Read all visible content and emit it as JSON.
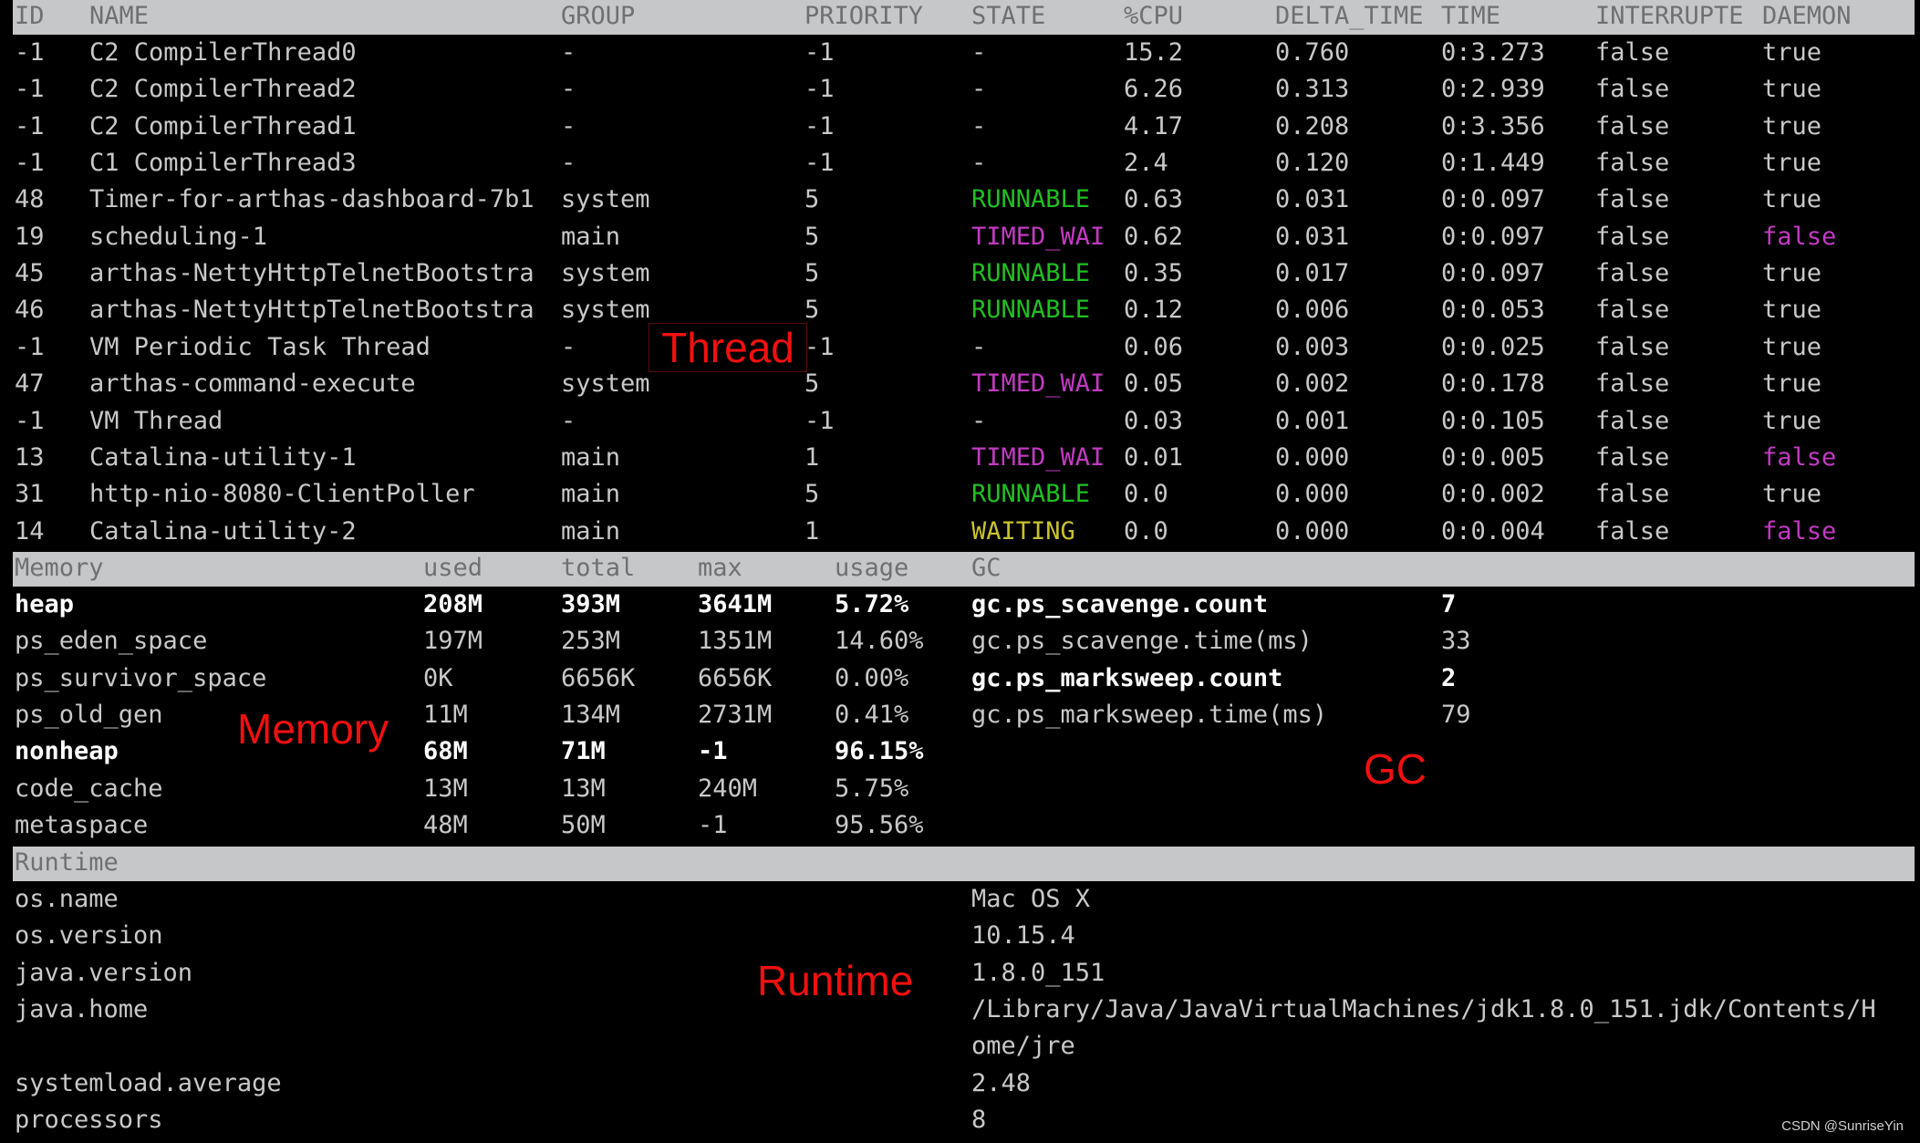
{
  "thread": {
    "headers": [
      "ID",
      "NAME",
      "GROUP",
      "PRIORITY",
      "STATE",
      "%CPU",
      "DELTA_TIME",
      "TIME",
      "INTERRUPTE",
      "DAEMON"
    ],
    "rows": [
      {
        "id": "-1",
        "name": "C2 CompilerThread0",
        "group": "-",
        "priority": "-1",
        "state": "-",
        "cpu": "15.2",
        "delta": "0.760",
        "time": "0:3.273",
        "interrupted": "false",
        "daemon": "true"
      },
      {
        "id": "-1",
        "name": "C2 CompilerThread2",
        "group": "-",
        "priority": "-1",
        "state": "-",
        "cpu": "6.26",
        "delta": "0.313",
        "time": "0:2.939",
        "interrupted": "false",
        "daemon": "true"
      },
      {
        "id": "-1",
        "name": "C2 CompilerThread1",
        "group": "-",
        "priority": "-1",
        "state": "-",
        "cpu": "4.17",
        "delta": "0.208",
        "time": "0:3.356",
        "interrupted": "false",
        "daemon": "true"
      },
      {
        "id": "-1",
        "name": "C1 CompilerThread3",
        "group": "-",
        "priority": "-1",
        "state": "-",
        "cpu": "2.4",
        "delta": "0.120",
        "time": "0:1.449",
        "interrupted": "false",
        "daemon": "true"
      },
      {
        "id": "48",
        "name": "Timer-for-arthas-dashboard-7b1",
        "group": "system",
        "priority": "5",
        "state": "RUNNABLE",
        "cpu": "0.63",
        "delta": "0.031",
        "time": "0:0.097",
        "interrupted": "false",
        "daemon": "true"
      },
      {
        "id": "19",
        "name": "scheduling-1",
        "group": "main",
        "priority": "5",
        "state": "TIMED_WAI",
        "cpu": "0.62",
        "delta": "0.031",
        "time": "0:0.097",
        "interrupted": "false",
        "daemon": "false"
      },
      {
        "id": "45",
        "name": "arthas-NettyHttpTelnetBootstra",
        "group": "system",
        "priority": "5",
        "state": "RUNNABLE",
        "cpu": "0.35",
        "delta": "0.017",
        "time": "0:0.097",
        "interrupted": "false",
        "daemon": "true"
      },
      {
        "id": "46",
        "name": "arthas-NettyHttpTelnetBootstra",
        "group": "system",
        "priority": "5",
        "state": "RUNNABLE",
        "cpu": "0.12",
        "delta": "0.006",
        "time": "0:0.053",
        "interrupted": "false",
        "daemon": "true"
      },
      {
        "id": "-1",
        "name": "VM Periodic Task Thread",
        "group": "-",
        "priority": "-1",
        "state": "-",
        "cpu": "0.06",
        "delta": "0.003",
        "time": "0:0.025",
        "interrupted": "false",
        "daemon": "true"
      },
      {
        "id": "47",
        "name": "arthas-command-execute",
        "group": "system",
        "priority": "5",
        "state": "TIMED_WAI",
        "cpu": "0.05",
        "delta": "0.002",
        "time": "0:0.178",
        "interrupted": "false",
        "daemon": "true"
      },
      {
        "id": "-1",
        "name": "VM Thread",
        "group": "-",
        "priority": "-1",
        "state": "-",
        "cpu": "0.03",
        "delta": "0.001",
        "time": "0:0.105",
        "interrupted": "false",
        "daemon": "true"
      },
      {
        "id": "13",
        "name": "Catalina-utility-1",
        "group": "main",
        "priority": "1",
        "state": "TIMED_WAI",
        "cpu": "0.01",
        "delta": "0.000",
        "time": "0:0.005",
        "interrupted": "false",
        "daemon": "false"
      },
      {
        "id": "31",
        "name": "http-nio-8080-ClientPoller",
        "group": "main",
        "priority": "5",
        "state": "RUNNABLE",
        "cpu": "0.0",
        "delta": "0.000",
        "time": "0:0.002",
        "interrupted": "false",
        "daemon": "true"
      },
      {
        "id": "14",
        "name": "Catalina-utility-2",
        "group": "main",
        "priority": "1",
        "state": "WAITING",
        "cpu": "0.0",
        "delta": "0.000",
        "time": "0:0.004",
        "interrupted": "false",
        "daemon": "false"
      }
    ]
  },
  "memory": {
    "headers": [
      "Memory",
      "used",
      "total",
      "max",
      "usage"
    ],
    "rows": [
      {
        "name": "heap",
        "used": "208M",
        "total": "393M",
        "max": "3641M",
        "usage": "5.72%",
        "bold": true
      },
      {
        "name": "ps_eden_space",
        "used": "197M",
        "total": "253M",
        "max": "1351M",
        "usage": "14.60%",
        "bold": false
      },
      {
        "name": "ps_survivor_space",
        "used": "0K",
        "total": "6656K",
        "max": "6656K",
        "usage": "0.00%",
        "bold": false
      },
      {
        "name": "ps_old_gen",
        "used": "11M",
        "total": "134M",
        "max": "2731M",
        "usage": "0.41%",
        "bold": false
      },
      {
        "name": "nonheap",
        "used": "68M",
        "total": "71M",
        "max": "-1",
        "usage": "96.15%",
        "bold": true
      },
      {
        "name": "code_cache",
        "used": "13M",
        "total": "13M",
        "max": "240M",
        "usage": "5.75%",
        "bold": false
      },
      {
        "name": "metaspace",
        "used": "48M",
        "total": "50M",
        "max": "-1",
        "usage": "95.56%",
        "bold": false
      }
    ]
  },
  "gc": {
    "header": "GC",
    "rows": [
      {
        "name": "gc.ps_scavenge.count",
        "value": "7",
        "bold": true
      },
      {
        "name": "gc.ps_scavenge.time(ms)",
        "value": "33",
        "bold": false
      },
      {
        "name": "gc.ps_marksweep.count",
        "value": "2",
        "bold": true
      },
      {
        "name": "gc.ps_marksweep.time(ms)",
        "value": "79",
        "bold": false
      }
    ]
  },
  "runtime": {
    "header": "Runtime",
    "rows": [
      {
        "key": "os.name",
        "value": "Mac OS X"
      },
      {
        "key": "os.version",
        "value": "10.15.4"
      },
      {
        "key": "java.version",
        "value": "1.8.0_151"
      },
      {
        "key": "java.home",
        "value": "/Library/Java/JavaVirtualMachines/jdk1.8.0_151.jdk/Contents/H"
      },
      {
        "key": "",
        "value": "ome/jre"
      },
      {
        "key": "systemload.average",
        "value": "2.48"
      },
      {
        "key": "processors",
        "value": "8"
      }
    ]
  },
  "annotations": {
    "thread": "Thread",
    "memory": "Memory",
    "gc": "GC",
    "runtime": "Runtime"
  },
  "colors": {
    "runnable": "#1fc01f",
    "timed_waiting": "#c23ac2",
    "waiting": "#c8c22a",
    "annotation": "#f01010",
    "header_bar": "#c6c7c9"
  },
  "watermark": "CSDN @SunriseYin"
}
